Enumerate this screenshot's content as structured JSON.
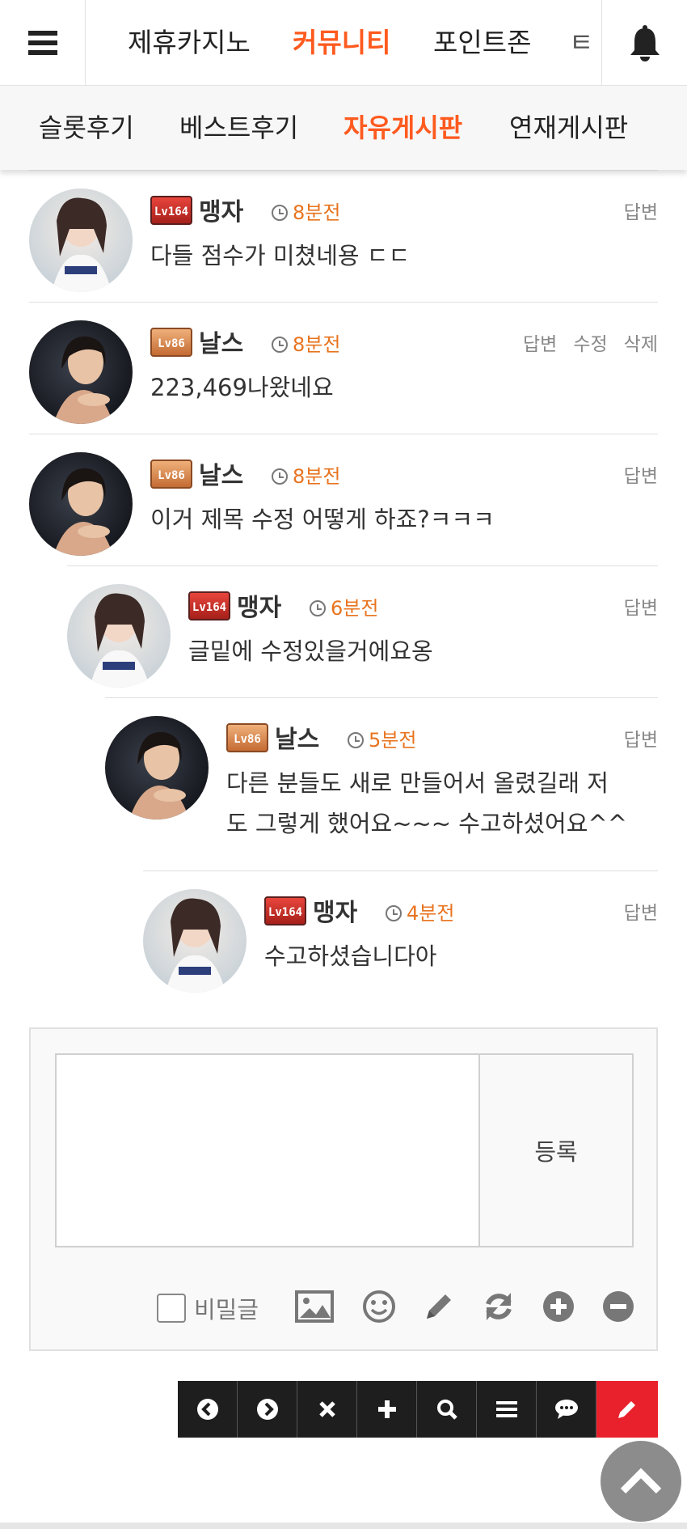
{
  "nav": {
    "tabs": [
      {
        "label": "제휴카지노"
      },
      {
        "label": "커뮤니티",
        "active": true
      },
      {
        "label": "포인트존"
      },
      {
        "label": "ㅌ"
      }
    ],
    "menu_icon": "hamburger-menu-icon",
    "bell_icon": "bell-icon"
  },
  "subnav": {
    "tabs": [
      {
        "label": "슬롯후기"
      },
      {
        "label": "베스트후기"
      },
      {
        "label": "자유게시판",
        "active": true
      },
      {
        "label": "연재게시판"
      }
    ]
  },
  "comments": [
    {
      "level": "164",
      "nickname": "맹자",
      "time": "8분전",
      "actions": [
        "답변"
      ],
      "text": "다들 점수가 미쳤네용 ㄷㄷ",
      "depth": 0
    },
    {
      "level": "86",
      "nickname": "날스",
      "time": "8분전",
      "actions": [
        "답변",
        "수정",
        "삭제"
      ],
      "text": "223,469나왔네요",
      "depth": 0
    },
    {
      "level": "86",
      "nickname": "날스",
      "time": "8분전",
      "actions": [
        "답변"
      ],
      "text": "이거 제목 수정 어떻게 하죠?ㅋㅋㅋ",
      "depth": 0
    },
    {
      "level": "164",
      "nickname": "맹자",
      "time": "6분전",
      "actions": [
        "답변"
      ],
      "text": "글밑에 수정있을거에요옹",
      "depth": 1
    },
    {
      "level": "86",
      "nickname": "날스",
      "time": "5분전",
      "actions": [
        "답변"
      ],
      "text_lines": [
        "다른 분들도 새로 만들어서 올렸길래 저",
        "도 그렇게 했어요~~~ 수고하셨어요^^"
      ],
      "depth": 2
    },
    {
      "level": "164",
      "nickname": "맹자",
      "time": "4분전",
      "actions": [
        "답변"
      ],
      "text": "수고하셨습니다아",
      "depth": 3
    }
  ],
  "reply": {
    "submit_label": "등록",
    "secret_label": "비밀글",
    "tools": [
      "image-icon",
      "emoji-icon",
      "pencil-icon",
      "refresh-icon",
      "plus-circle-icon",
      "minus-circle-icon"
    ]
  },
  "toolbar": {
    "buttons": [
      "chevron-left-icon",
      "chevron-right-icon",
      "close-icon",
      "plus-icon",
      "search-icon",
      "list-icon",
      "comment-icon",
      "write-icon"
    ],
    "write_color": "#e8212c"
  },
  "accent_color": "#ff5a1f",
  "time_color": "#e8741f"
}
